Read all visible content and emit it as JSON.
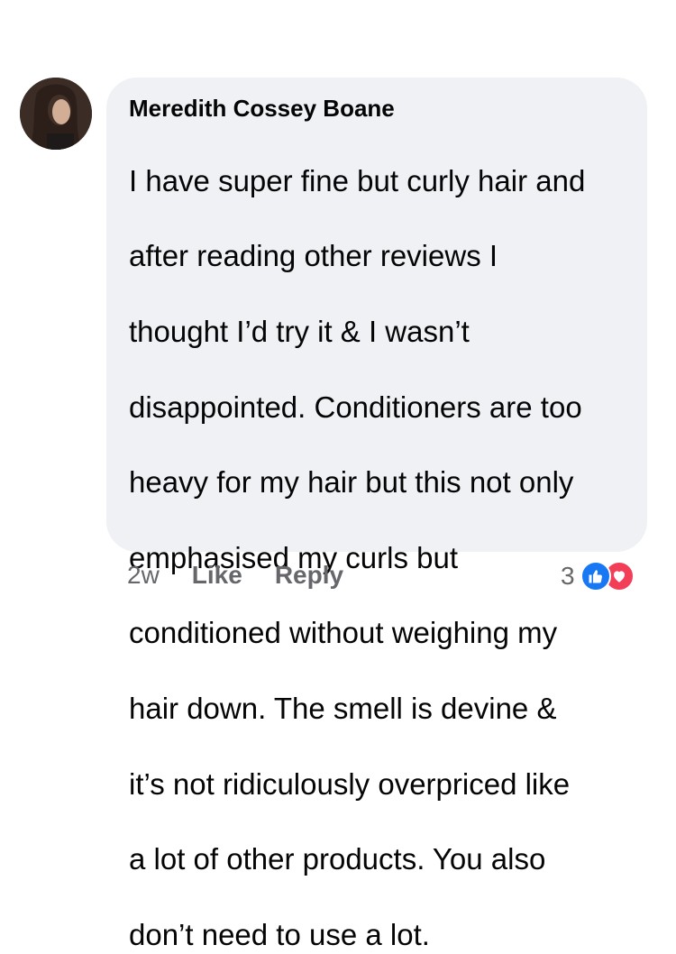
{
  "comment": {
    "author": "Meredith Cossey Boane",
    "lines": [
      "I have super fine but curly hair and",
      "after reading other reviews I",
      "thought I’d try it & I wasn’t",
      "disappointed. Conditioners are too",
      "heavy for my hair but this not only",
      "emphasised my curls but",
      "conditioned without weighing my",
      "hair down. The smell is devine &",
      "it’s not ridiculously overpriced like",
      "a lot of other products. You also",
      "don’t need to use a lot."
    ]
  },
  "actions": {
    "time": "2w",
    "like_label": "Like",
    "reply_label": "Reply"
  },
  "reactions": {
    "count": "3",
    "icons": [
      "thumbs-up-icon",
      "heart-icon"
    ],
    "like_color": "#1877f2",
    "love_color": "#f33e58"
  },
  "colors": {
    "bubble": "#eff1f4",
    "text": "#050505",
    "secondary": "#65676b"
  }
}
